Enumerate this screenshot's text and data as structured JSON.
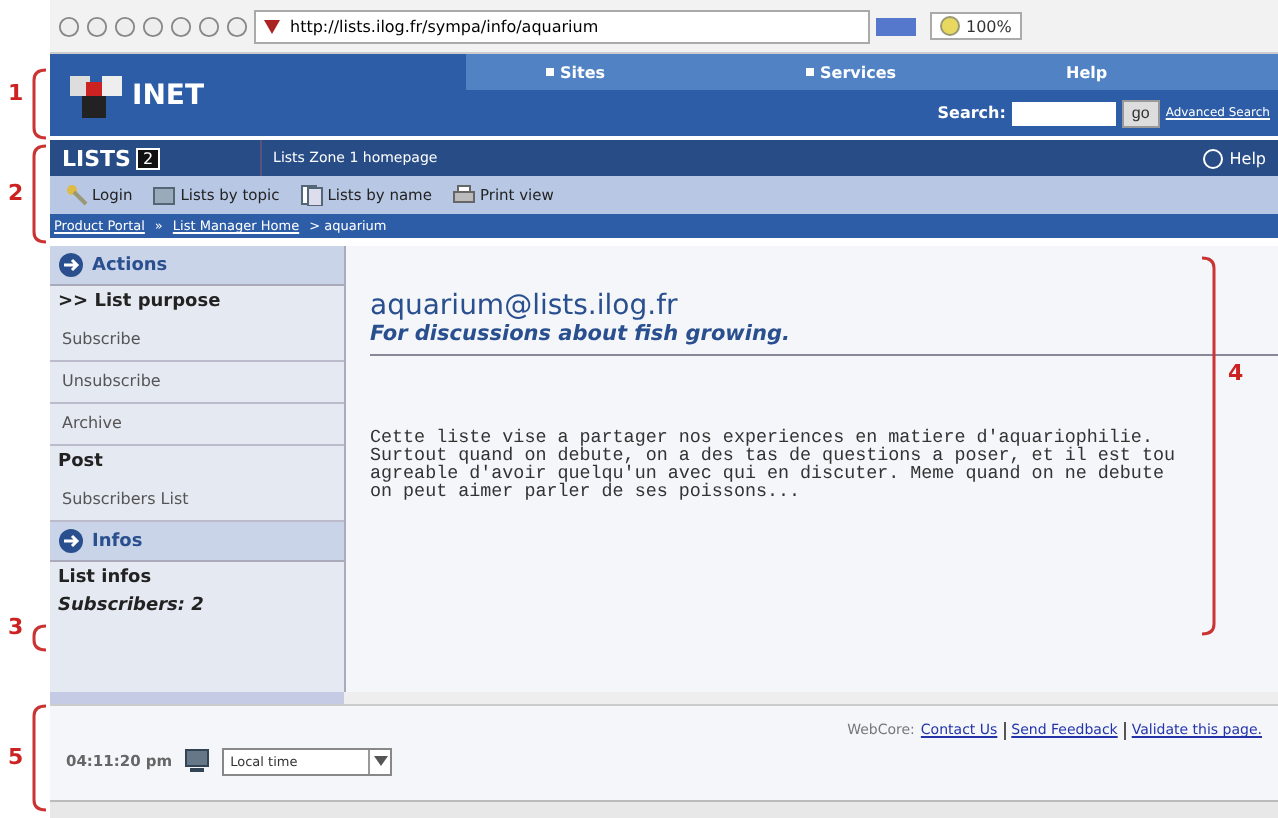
{
  "browser": {
    "url": "http://lists.ilog.fr/sympa/info/aquarium",
    "zoom": "100%"
  },
  "header": {
    "logo": "INET",
    "nav": [
      {
        "label": "Sites",
        "kind": "menu"
      },
      {
        "label": "Services",
        "kind": "menu"
      },
      {
        "label": "Help",
        "kind": "plain"
      }
    ],
    "search_label": "Search:",
    "search_button": "go",
    "advanced_link": "Advanced Search"
  },
  "lists_bar": {
    "title": "LISTS",
    "badge": "2",
    "home": "Lists Zone 1 homepage",
    "help": "Help"
  },
  "toolbar": [
    {
      "label": "Login",
      "kind": "key"
    },
    {
      "label": "Lists by topic",
      "kind": "topic"
    },
    {
      "label": "Lists by name",
      "kind": "name"
    },
    {
      "label": "Print view",
      "kind": "print"
    }
  ],
  "breadcrumb": [
    {
      "label": "Product Portal",
      "kind": "link"
    },
    {
      "label": "»",
      "kind": "sep"
    },
    {
      "label": "List Manager Home",
      "kind": "link"
    },
    {
      "label": "> aquarium",
      "kind": "current"
    }
  ],
  "sidebar": [
    {
      "title": "Actions",
      "items": [
        {
          "label": ">> List purpose",
          "kind": "heading"
        },
        {
          "label": "Subscribe",
          "kind": "link"
        },
        {
          "label": "Unsubscribe",
          "kind": "link"
        },
        {
          "label": "Archive",
          "kind": "link"
        },
        {
          "label": "Post",
          "kind": "heading"
        },
        {
          "label": "Subscribers List",
          "kind": "link"
        }
      ]
    },
    {
      "title": "Infos",
      "items": [
        {
          "label": "List infos",
          "kind": "heading"
        },
        {
          "label": "Subscribers: 2",
          "kind": "note"
        }
      ]
    }
  ],
  "content": {
    "title": "aquarium@lists.ilog.fr",
    "subtitle": "For discussions about fish growing.",
    "body": [
      "Cette liste vise a partager nos experiences en matiere d'aquariophilie.",
      "Surtout quand on debute, on a des tas de questions a poser, et il est tou",
      "agreable d'avoir quelqu'un avec qui en discuter. Meme quand on ne debute",
      "on peut aimer parler de ses poissons..."
    ]
  },
  "footer": {
    "time": "04:11:20 pm",
    "timezone": "Local time",
    "label": "WebCore:",
    "links": [
      "Contact Us",
      "Send Feedback",
      "Validate this page."
    ]
  },
  "annotations": [
    "1",
    "2",
    "3",
    "4",
    "5"
  ]
}
